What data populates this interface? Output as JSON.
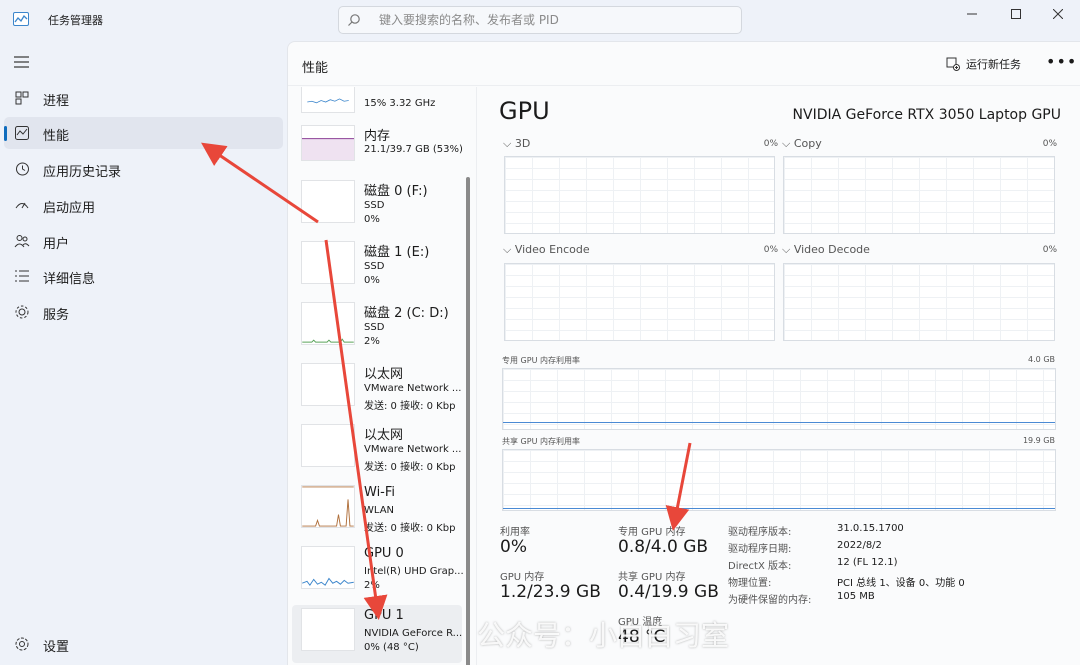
{
  "app": {
    "title": "任务管理器"
  },
  "search": {
    "placeholder": "键入要搜索的名称、发布者或 PID"
  },
  "sidebar": {
    "items": [
      {
        "label": "进程",
        "icon": "processes-icon"
      },
      {
        "label": "性能",
        "icon": "performance-icon",
        "active": true
      },
      {
        "label": "应用历史记录",
        "icon": "history-icon"
      },
      {
        "label": "启动应用",
        "icon": "startup-icon"
      },
      {
        "label": "用户",
        "icon": "users-icon"
      },
      {
        "label": "详细信息",
        "icon": "details-icon"
      },
      {
        "label": "服务",
        "icon": "services-icon"
      }
    ],
    "settings_label": "设置"
  },
  "header": {
    "title": "性能",
    "run_task_label": "运行新任务",
    "more_label": "•••"
  },
  "devices": [
    {
      "name": "",
      "line1": "15% 3.32 GHz",
      "line2": ""
    },
    {
      "name": "内存",
      "line1": "21.1/39.7 GB (53%)",
      "line2": ""
    },
    {
      "name": "磁盘 0 (F:)",
      "line1": "SSD",
      "line2": "0%"
    },
    {
      "name": "磁盘 1 (E:)",
      "line1": "SSD",
      "line2": "0%"
    },
    {
      "name": "磁盘 2 (C: D:)",
      "line1": "SSD",
      "line2": "2%"
    },
    {
      "name": "以太网",
      "line1": "VMware Network ...",
      "line2": "发送: 0 接收: 0 Kbp"
    },
    {
      "name": "以太网",
      "line1": "VMware Network ...",
      "line2": "发送: 0 接收: 0 Kbp"
    },
    {
      "name": "Wi-Fi",
      "line1": "WLAN",
      "line2": "发送: 0 接收: 0 Kbp"
    },
    {
      "name": "GPU 0",
      "line1": "Intel(R) UHD Grap...",
      "line2": "2%"
    },
    {
      "name": "GPU 1",
      "line1": "NVIDIA GeForce R...",
      "line2": "0% (48 °C)"
    }
  ],
  "gpu": {
    "title": "GPU",
    "model": "NVIDIA GeForce RTX 3050 Laptop GPU",
    "engines": [
      {
        "label": "3D",
        "pct": "0%"
      },
      {
        "label": "Copy",
        "pct": "0%"
      },
      {
        "label": "Video Encode",
        "pct": "0%"
      },
      {
        "label": "Video Decode",
        "pct": "0%"
      }
    ],
    "dedicated_chart": {
      "label": "专用 GPU 内存利用率",
      "max": "4.0 GB",
      "usage_fraction": 0.1
    },
    "shared_chart": {
      "label": "共享 GPU 内存利用率",
      "max": "19.9 GB",
      "usage_fraction": 0.02
    },
    "stats": {
      "util_label": "利用率",
      "util_value": "0%",
      "ded_label": "专用 GPU 内存",
      "ded_value": "0.8/4.0 GB",
      "gpu_mem_label": "GPU 内存",
      "gpu_mem_value": "1.2/23.9 GB",
      "shared_label": "共享 GPU 内存",
      "shared_value": "0.4/19.9 GB",
      "temp_label": "GPU 温度",
      "temp_value": "48 °C"
    },
    "info": [
      {
        "k": "驱动程序版本:",
        "v": "31.0.15.1700"
      },
      {
        "k": "驱动程序日期:",
        "v": "2022/8/2"
      },
      {
        "k": "DirectX 版本:",
        "v": "12 (FL 12.1)"
      },
      {
        "k": "物理位置:",
        "v": "PCI 总线 1、设备 0、功能 0"
      },
      {
        "k": "为硬件保留的内存:",
        "v": "105 MB"
      }
    ]
  },
  "watermark": "公众号：小白白习室",
  "colors": {
    "accent": "#0f6cbd",
    "annotation": "#e8473a",
    "memory_graph": "#8c3f96",
    "cpu_graph": "#3c86cc",
    "disk_graph": "#5aa35a",
    "wifi_graph": "#b0703c"
  }
}
